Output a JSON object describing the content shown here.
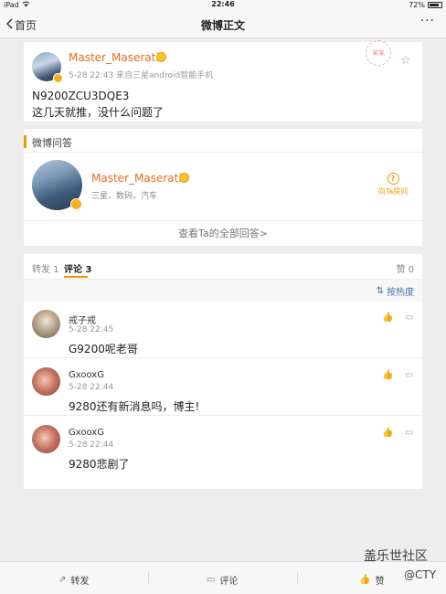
{
  "status": {
    "device": "iPad",
    "wifi_icon": "wifi-icon",
    "time": "22:46",
    "battery": "72%"
  },
  "nav": {
    "back": "首页",
    "title": "微博正文",
    "more": "···"
  },
  "post": {
    "author": "Master_Maserati",
    "meta": "5-28 22:43  来自三星android智能手机",
    "line1": "N9200ZCU3DQE3",
    "line2": "这几天就推，没什么问题了",
    "stamp": "某某"
  },
  "qa": {
    "header": "微博问答",
    "name": "Master_Maserati",
    "tags": "三星，数码，汽车",
    "ask_label": "向Ta提问",
    "view_all": "查看Ta的全部回答>"
  },
  "comments": {
    "tab_repost": "转发 1",
    "tab_comment": "评论 3",
    "tab_like": "赞 0",
    "sort_label": "按热度",
    "items": [
      {
        "name": "戒子戒",
        "time": "5-28 22:45",
        "text": "G9200呢老哥"
      },
      {
        "name": "GxooxG",
        "time": "5-28 22:44",
        "text": "9280还有新消息吗，博主!"
      },
      {
        "name": "GxooxG",
        "time": "5-28 22:44",
        "text": "9280悲剧了"
      }
    ]
  },
  "bottom": {
    "repost": "转发",
    "comment": "评论",
    "like": "赞"
  },
  "watermark": {
    "line1": "盖乐世社区",
    "line2": "@CTY"
  }
}
